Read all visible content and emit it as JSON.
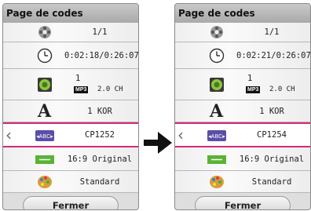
{
  "panels": [
    {
      "title": "Page de codes",
      "rows": {
        "title_num": "1/1",
        "time": "0:02:18/0:26:07",
        "audio_num": "1",
        "audio_format": "MP3",
        "audio_channels": "2.0 CH",
        "subtitle_lang": "1 KOR",
        "code_page": "CP1252",
        "aspect": "16:9 Original",
        "picture_mode": "Standard"
      },
      "close_label": "Fermer"
    },
    {
      "title": "Page de codes",
      "rows": {
        "title_num": "1/1",
        "time": "0:02:21/0:26:07",
        "audio_num": "1",
        "audio_format": "MP3",
        "audio_channels": "2.0 CH",
        "subtitle_lang": "1 KOR",
        "code_page": "CP1254",
        "aspect": "16:9 Original",
        "picture_mode": "Standard"
      },
      "close_label": "Fermer"
    }
  ],
  "icons": [
    "title-reel-icon",
    "clock-icon",
    "speaker-icon",
    "subtitle-a-icon",
    "abc-code-icon",
    "aspect-ratio-icon",
    "palette-icon",
    "right-arrow-icon"
  ],
  "colors": {
    "selection": "#d6287a"
  }
}
